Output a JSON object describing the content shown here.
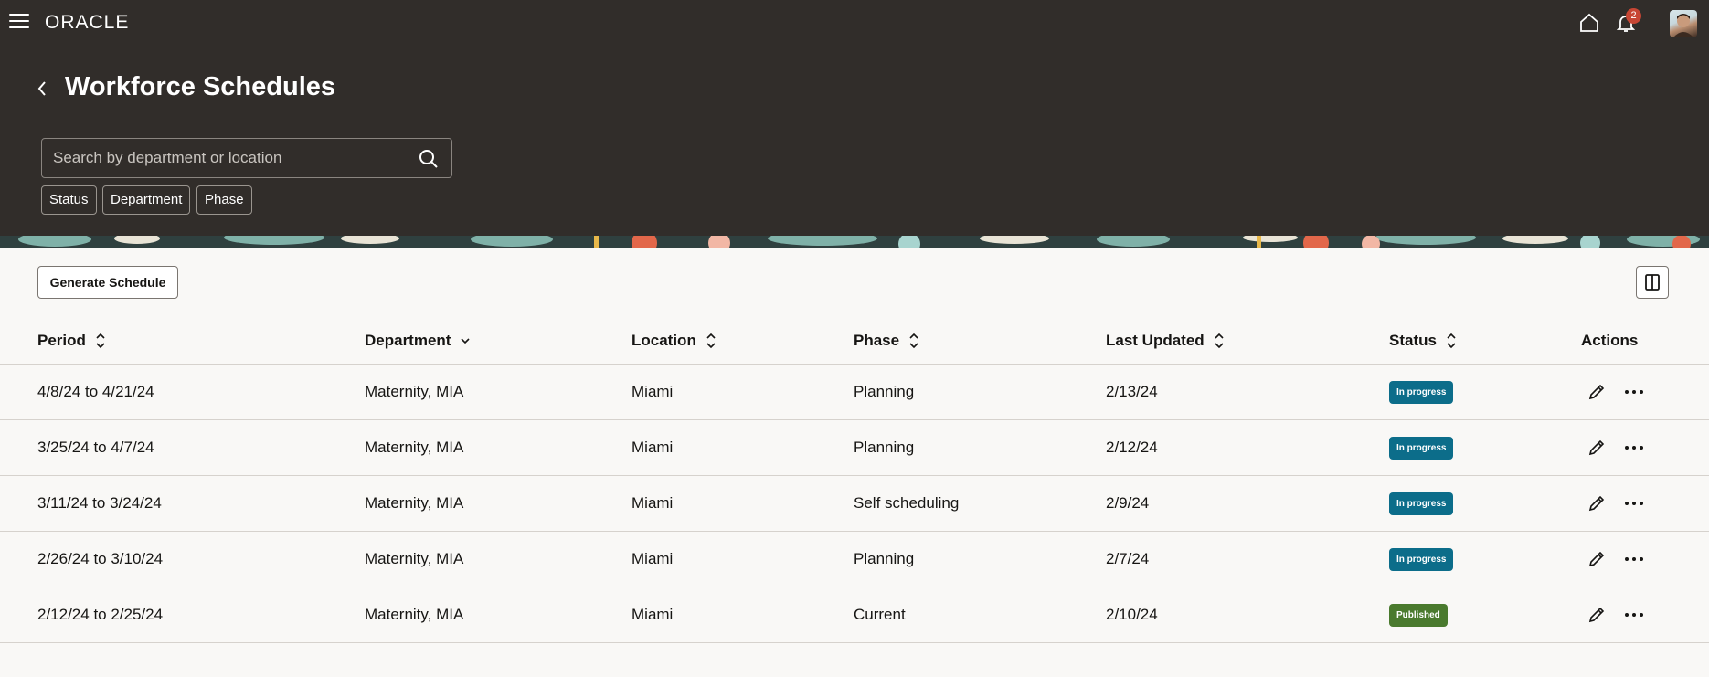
{
  "brand": {
    "logo_text": "ORACLE"
  },
  "notifications": {
    "count": "2"
  },
  "page": {
    "title": "Workforce Schedules"
  },
  "search": {
    "placeholder": "Search by department or location"
  },
  "filters": [
    "Status",
    "Department",
    "Phase"
  ],
  "toolbar": {
    "generate_label": "Generate Schedule"
  },
  "table": {
    "columns": [
      "Period",
      "Department",
      "Location",
      "Phase",
      "Last Updated",
      "Status",
      "Actions"
    ],
    "rows": [
      {
        "period": "4/8/24 to 4/21/24",
        "department": "Maternity, MIA",
        "location": "Miami",
        "phase": "Planning",
        "last_updated": "2/13/24",
        "status": "In progress"
      },
      {
        "period": "3/25/24 to 4/7/24",
        "department": "Maternity, MIA",
        "location": "Miami",
        "phase": "Planning",
        "last_updated": "2/12/24",
        "status": "In progress"
      },
      {
        "period": "3/11/24 to 3/24/24",
        "department": "Maternity, MIA",
        "location": "Miami",
        "phase": "Self scheduling",
        "last_updated": "2/9/24",
        "status": "In progress"
      },
      {
        "period": "2/26/24 to 3/10/24",
        "department": "Maternity, MIA",
        "location": "Miami",
        "phase": "Planning",
        "last_updated": "2/7/24",
        "status": "In progress"
      },
      {
        "period": "2/12/24 to 2/25/24",
        "department": "Maternity, MIA",
        "location": "Miami",
        "phase": "Current",
        "last_updated": "2/10/24",
        "status": "Published"
      }
    ]
  },
  "colors": {
    "header_bg": "#312d2a",
    "in_progress": "#0c6d8a",
    "published": "#4a7a2e",
    "badge": "#c74634"
  },
  "icons": [
    "hamburger-menu-icon",
    "home-icon",
    "bell-icon",
    "back-arrow-icon",
    "search-icon",
    "sort-icon",
    "chevron-down-icon",
    "panel-toggle-icon",
    "edit-pencil-icon",
    "more-options-icon"
  ]
}
